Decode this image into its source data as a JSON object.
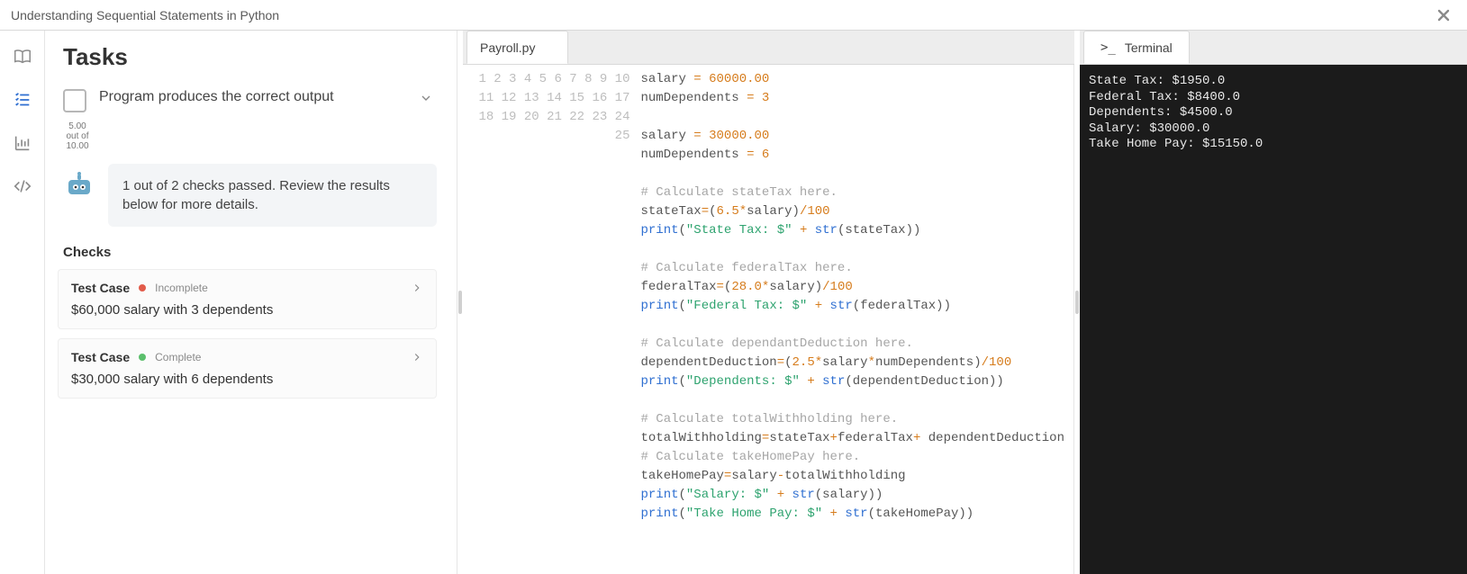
{
  "header": {
    "title": "Understanding Sequential Statements in Python"
  },
  "rail": {
    "items": [
      {
        "name": "book-icon"
      },
      {
        "name": "list-icon"
      },
      {
        "name": "chart-icon"
      },
      {
        "name": "code-icon"
      }
    ]
  },
  "tasks": {
    "heading": "Tasks",
    "item": {
      "label": "Program produces the correct output"
    },
    "score": {
      "earned": "5.00",
      "middle": "out of",
      "total": "10.00"
    },
    "bot_msg": "1 out of 2 checks passed. Review the results below for more details.",
    "checks_heading": "Checks",
    "cases": [
      {
        "label": "Test Case",
        "status": "Incomplete",
        "color": "red",
        "desc": "$60,000 salary with 3 dependents"
      },
      {
        "label": "Test Case",
        "status": "Complete",
        "color": "green",
        "desc": "$30,000 salary with 6 dependents"
      }
    ]
  },
  "editor": {
    "tab": "Payroll.py",
    "lines": [
      [
        {
          "t": "id",
          "v": "salary "
        },
        {
          "t": "op",
          "v": "="
        },
        {
          "t": "id",
          "v": " "
        },
        {
          "t": "num",
          "v": "60000.00"
        }
      ],
      [
        {
          "t": "id",
          "v": "numDependents "
        },
        {
          "t": "op",
          "v": "="
        },
        {
          "t": "id",
          "v": " "
        },
        {
          "t": "num",
          "v": "3"
        }
      ],
      [],
      [
        {
          "t": "id",
          "v": "salary "
        },
        {
          "t": "op",
          "v": "="
        },
        {
          "t": "id",
          "v": " "
        },
        {
          "t": "num",
          "v": "30000.00"
        }
      ],
      [
        {
          "t": "id",
          "v": "numDependents "
        },
        {
          "t": "op",
          "v": "="
        },
        {
          "t": "id",
          "v": " "
        },
        {
          "t": "num",
          "v": "6"
        }
      ],
      [],
      [
        {
          "t": "cm",
          "v": "# Calculate stateTax here."
        }
      ],
      [
        {
          "t": "id",
          "v": "stateTax"
        },
        {
          "t": "op",
          "v": "="
        },
        {
          "t": "id",
          "v": "("
        },
        {
          "t": "num",
          "v": "6.5"
        },
        {
          "t": "op",
          "v": "*"
        },
        {
          "t": "id",
          "v": "salary)"
        },
        {
          "t": "op",
          "v": "/"
        },
        {
          "t": "num",
          "v": "100"
        }
      ],
      [
        {
          "t": "fn",
          "v": "print"
        },
        {
          "t": "id",
          "v": "("
        },
        {
          "t": "str",
          "v": "\"State Tax: $\""
        },
        {
          "t": "id",
          "v": " "
        },
        {
          "t": "op",
          "v": "+"
        },
        {
          "t": "id",
          "v": " "
        },
        {
          "t": "fn",
          "v": "str"
        },
        {
          "t": "id",
          "v": "(stateTax))"
        }
      ],
      [],
      [
        {
          "t": "cm",
          "v": "# Calculate federalTax here."
        }
      ],
      [
        {
          "t": "id",
          "v": "federalTax"
        },
        {
          "t": "op",
          "v": "="
        },
        {
          "t": "id",
          "v": "("
        },
        {
          "t": "num",
          "v": "28.0"
        },
        {
          "t": "op",
          "v": "*"
        },
        {
          "t": "id",
          "v": "salary)"
        },
        {
          "t": "op",
          "v": "/"
        },
        {
          "t": "num",
          "v": "100"
        }
      ],
      [
        {
          "t": "fn",
          "v": "print"
        },
        {
          "t": "id",
          "v": "("
        },
        {
          "t": "str",
          "v": "\"Federal Tax: $\""
        },
        {
          "t": "id",
          "v": " "
        },
        {
          "t": "op",
          "v": "+"
        },
        {
          "t": "id",
          "v": " "
        },
        {
          "t": "fn",
          "v": "str"
        },
        {
          "t": "id",
          "v": "(federalTax))"
        }
      ],
      [],
      [
        {
          "t": "cm",
          "v": "# Calculate dependantDeduction here."
        }
      ],
      [
        {
          "t": "id",
          "v": "dependentDeduction"
        },
        {
          "t": "op",
          "v": "="
        },
        {
          "t": "id",
          "v": "("
        },
        {
          "t": "num",
          "v": "2.5"
        },
        {
          "t": "op",
          "v": "*"
        },
        {
          "t": "id",
          "v": "salary"
        },
        {
          "t": "op",
          "v": "*"
        },
        {
          "t": "id",
          "v": "numDependents)"
        },
        {
          "t": "op",
          "v": "/"
        },
        {
          "t": "num",
          "v": "100"
        }
      ],
      [
        {
          "t": "fn",
          "v": "print"
        },
        {
          "t": "id",
          "v": "("
        },
        {
          "t": "str",
          "v": "\"Dependents: $\""
        },
        {
          "t": "id",
          "v": " "
        },
        {
          "t": "op",
          "v": "+"
        },
        {
          "t": "id",
          "v": " "
        },
        {
          "t": "fn",
          "v": "str"
        },
        {
          "t": "id",
          "v": "(dependentDeduction))"
        }
      ],
      [],
      [
        {
          "t": "cm",
          "v": "# Calculate totalWithholding here."
        }
      ],
      [
        {
          "t": "id",
          "v": "totalWithholding"
        },
        {
          "t": "op",
          "v": "="
        },
        {
          "t": "id",
          "v": "stateTax"
        },
        {
          "t": "op",
          "v": "+"
        },
        {
          "t": "id",
          "v": "federalTax"
        },
        {
          "t": "op",
          "v": "+"
        },
        {
          "t": "id",
          "v": " dependentDeduction"
        }
      ],
      [
        {
          "t": "cm",
          "v": "# Calculate takeHomePay here."
        }
      ],
      [
        {
          "t": "id",
          "v": "takeHomePay"
        },
        {
          "t": "op",
          "v": "="
        },
        {
          "t": "id",
          "v": "salary"
        },
        {
          "t": "op",
          "v": "-"
        },
        {
          "t": "id",
          "v": "totalWithholding"
        }
      ],
      [
        {
          "t": "fn",
          "v": "print"
        },
        {
          "t": "id",
          "v": "("
        },
        {
          "t": "str",
          "v": "\"Salary: $\""
        },
        {
          "t": "id",
          "v": " "
        },
        {
          "t": "op",
          "v": "+"
        },
        {
          "t": "id",
          "v": " "
        },
        {
          "t": "fn",
          "v": "str"
        },
        {
          "t": "id",
          "v": "(salary))"
        }
      ],
      [
        {
          "t": "fn",
          "v": "print"
        },
        {
          "t": "id",
          "v": "("
        },
        {
          "t": "str",
          "v": "\"Take Home Pay: $\""
        },
        {
          "t": "id",
          "v": " "
        },
        {
          "t": "op",
          "v": "+"
        },
        {
          "t": "id",
          "v": " "
        },
        {
          "t": "fn",
          "v": "str"
        },
        {
          "t": "id",
          "v": "(takeHomePay))"
        }
      ],
      []
    ]
  },
  "terminal": {
    "tab": "Terminal",
    "output": "State Tax: $1950.0\nFederal Tax: $8400.0\nDependents: $4500.0\nSalary: $30000.0\nTake Home Pay: $15150.0"
  }
}
